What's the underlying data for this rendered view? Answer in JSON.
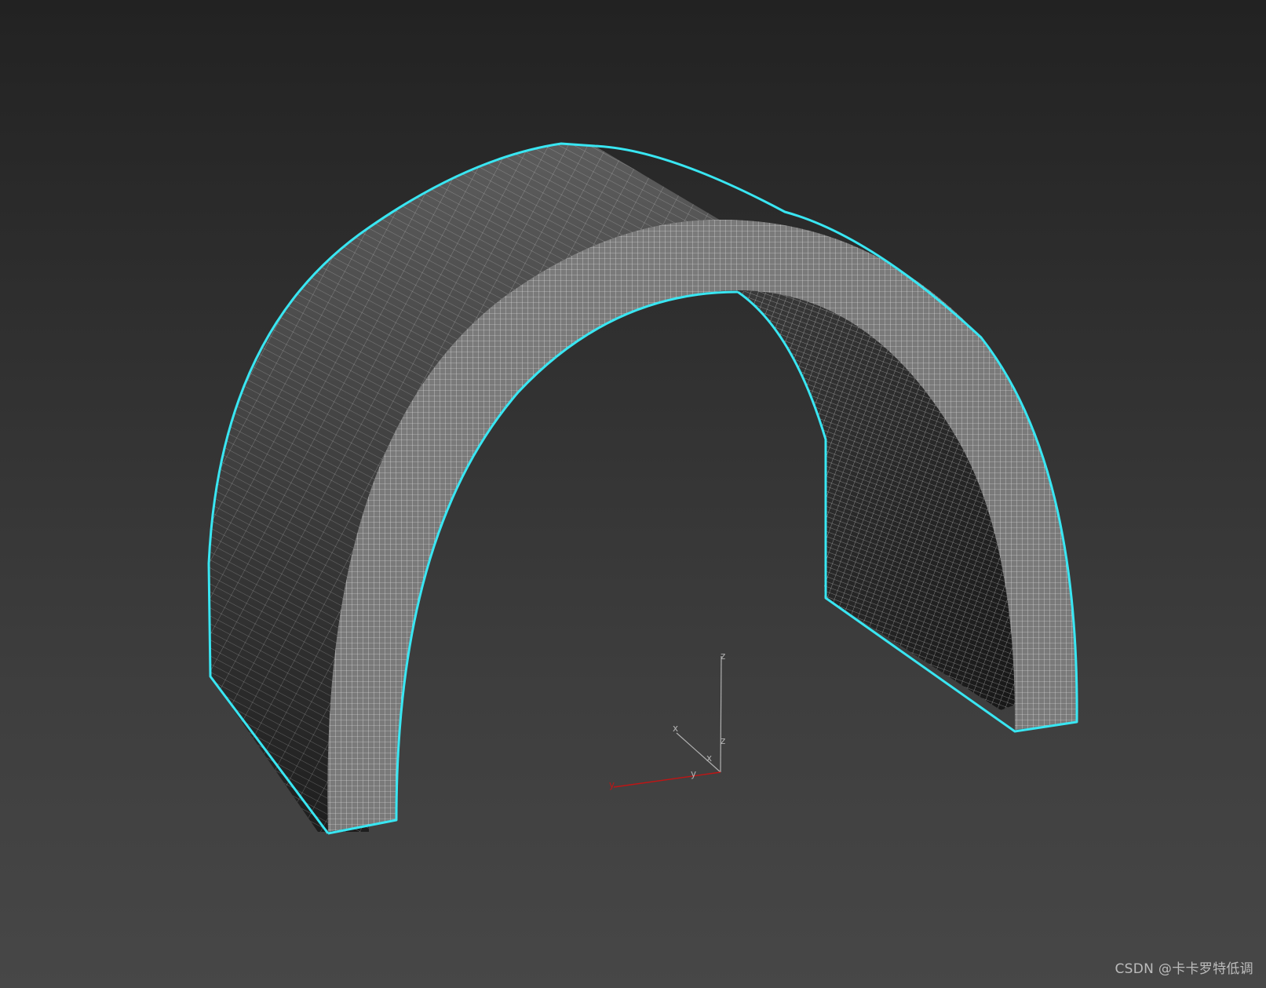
{
  "viewport": {
    "background_top": "#222222",
    "background_bottom": "#474747"
  },
  "model": {
    "shape": "arch",
    "wire_color": "#ffffff",
    "selection_outline_color": "#39e6f2",
    "surface_color_dark": "#1d1d1d",
    "surface_color_light": "#5a5a5a"
  },
  "gizmo": {
    "x_label": "x",
    "y_label": "y",
    "z_label": "z",
    "x_label_2": "x",
    "y_label_2": "y",
    "z_label_2": "z",
    "x_color": "#b0b0b0",
    "y_color": "#c01515",
    "z_color": "#b0b0b0"
  },
  "watermark": {
    "text": "CSDN @卡卡罗特低调"
  }
}
